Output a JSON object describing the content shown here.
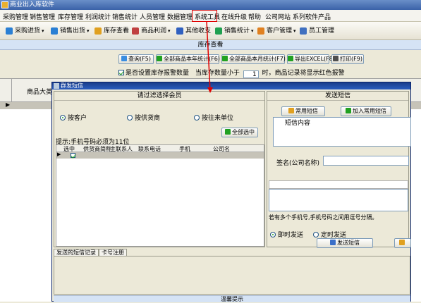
{
  "window": {
    "title": "商业出入库软件"
  },
  "menu": [
    "采购管理",
    "销售管理",
    "库存管理",
    "利润统计",
    "销售统计",
    "人员管理",
    "数据管理",
    "系统工具",
    "在线升级",
    "帮助",
    "公司网站",
    "系列软件产品"
  ],
  "toolbar": [
    {
      "label": "采购进货",
      "color": "#2a7fd4"
    },
    {
      "label": "销售出货",
      "color": "#2a7fd4"
    },
    {
      "label": "库存查看",
      "color": "#e0a020"
    },
    {
      "label": "商品利润",
      "color": "#c04040"
    },
    {
      "label": "其他收支",
      "color": "#3060c0"
    },
    {
      "label": "销售统计",
      "color": "#20a050"
    },
    {
      "label": "客户管理",
      "color": "#e08020"
    },
    {
      "label": "员工管理",
      "color": "#4070c0"
    }
  ],
  "section": {
    "title": "库存查看"
  },
  "query_buttons": [
    {
      "label": "查询(F5)",
      "color": "#3a8de0"
    },
    {
      "label": "全部商品本年统计(F6)",
      "color": "#21a121"
    },
    {
      "label": "全部商品本月统计(F7)",
      "color": "#21a121"
    },
    {
      "label": "导出EXCEL(F8)",
      "color": "#21a121"
    },
    {
      "label": "打印(F9)",
      "color": "#505050"
    }
  ],
  "alert": {
    "checkbox_label": "是否设置库存报警数量",
    "prefix": "当库存数量小于",
    "value": "1",
    "unit": "时，商品记录将显示红色报警"
  },
  "grid": {
    "col1": "商品大类"
  },
  "dialog": {
    "title": "群发短信",
    "left_header": "请过滤选择会员",
    "radios": [
      "按客户",
      "按供货商",
      "按往来单位"
    ],
    "select_all": "全部选中",
    "hint": "提示:手机号码必须为11位",
    "columns": [
      "选中",
      "供货商简称",
      "主联系人",
      "联系电话",
      "手机",
      "公司名"
    ],
    "right_header": "发送短信",
    "common_sms": "常用短信",
    "add_common": "加入常用短信",
    "content_label": "短信内容",
    "signature_label": "签名(公司名称)",
    "multi_hint": "若有多个手机号,手机号码之间用逗号分隔。",
    "send_now": "即时发送",
    "scheduled": "定时发送",
    "send_btn": "发送短信",
    "tabs": [
      "发送的短信记录",
      "卡号注册"
    ],
    "footer": "温馨提示"
  },
  "colors": {
    "highlight": "#e00000",
    "selection": "#c6c3b8"
  }
}
